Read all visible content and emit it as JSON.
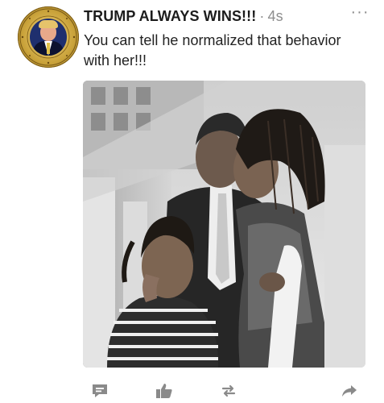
{
  "post": {
    "author": "TRUMP ALWAYS WINS!!!",
    "separator": "·",
    "time": "4s",
    "text": "You can tell he normalized that behavior with her!!!",
    "more_label": "···"
  },
  "avatar": {
    "icon": "presidential-seal-avatar",
    "seal_ring_color": "#c9a23a",
    "inner_color": "#1f2f6e"
  },
  "photo": {
    "icon": "photo-family",
    "palette": "grayscale"
  },
  "actions": [
    {
      "icon": "comment-icon"
    },
    {
      "icon": "like-icon"
    },
    {
      "icon": "repost-icon"
    },
    {
      "icon": "share-icon"
    }
  ],
  "colors": {
    "text": "#1c1c1c",
    "muted": "#8e8e8e",
    "icon": "#8a8a8a"
  }
}
